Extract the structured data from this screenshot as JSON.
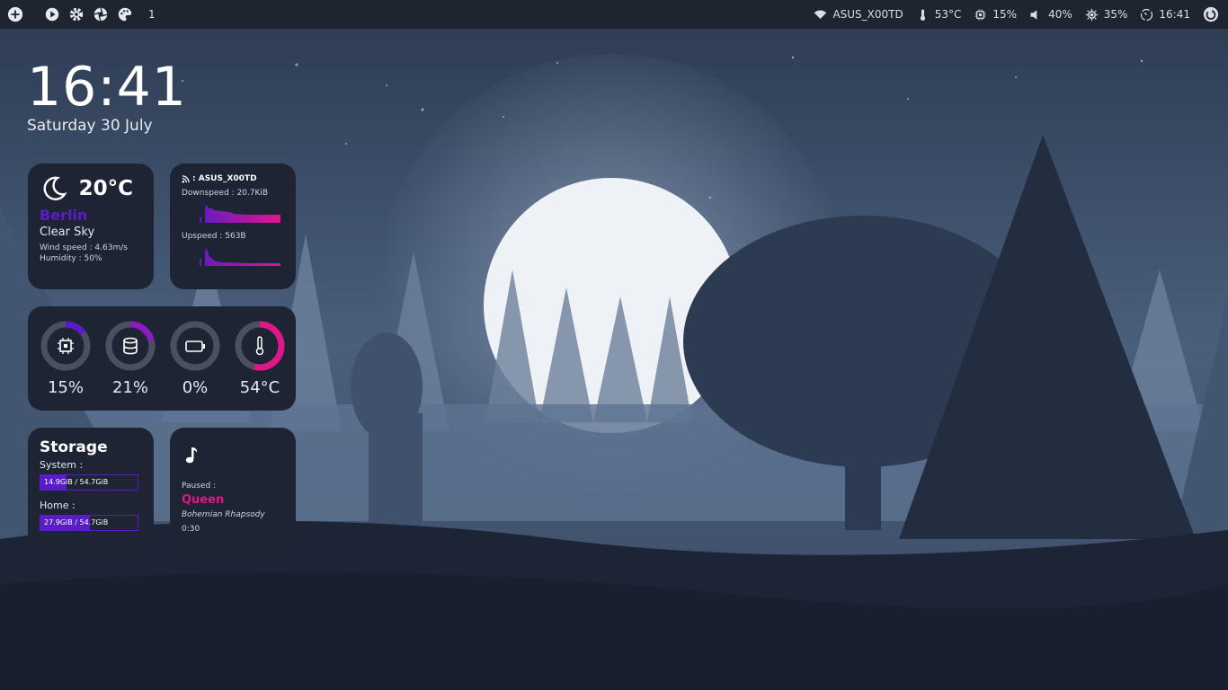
{
  "colors": {
    "bar_bg": "#1e2430",
    "card_bg": "#1e2433",
    "accent_purple": "#5a1cc8",
    "accent_pink": "#e0168a",
    "gauge_track": "#4a5060"
  },
  "topbar": {
    "left_icons": [
      "add-circle-icon",
      "play-icon",
      "settings-icon",
      "aperture-icon",
      "palette-icon"
    ],
    "workspace": "1",
    "wifi": {
      "icon": "wifi-icon",
      "label": "ASUS_X00TD"
    },
    "temp": {
      "icon": "thermometer-icon",
      "label": "53°C"
    },
    "cpu": {
      "icon": "cpu-icon",
      "label": "15%"
    },
    "volume": {
      "icon": "volume-icon",
      "label": "40%"
    },
    "brightness": {
      "icon": "brightness-icon",
      "label": "35%"
    },
    "clock": {
      "icon": "clock-icon",
      "label": "16:41"
    },
    "power": {
      "icon": "power-icon"
    }
  },
  "clock": {
    "time": "16:41",
    "date": "Saturday 30 July"
  },
  "weather": {
    "icon": "moon-icon",
    "temp": "20°C",
    "city": "Berlin",
    "condition": "Clear Sky",
    "wind": "Wind speed : 4.63m/s",
    "humidity": "Humidity : 50%"
  },
  "network": {
    "title": ": ASUS_X00TD",
    "down_label": "Downspeed : 20.7KiB",
    "up_label": "Upspeed : 563B"
  },
  "stats": [
    {
      "icon": "cpu-icon",
      "value": "15%",
      "fraction": 0.15
    },
    {
      "icon": "disk-icon",
      "value": "21%",
      "fraction": 0.21
    },
    {
      "icon": "battery-icon",
      "value": "0%",
      "fraction": 0.0
    },
    {
      "icon": "thermometer-icon",
      "value": "54°C",
      "fraction": 0.54
    }
  ],
  "storage": {
    "title": "Storage",
    "system_label": "System :",
    "system_text": "14.9GiB / 54.7GiB",
    "system_fraction": 0.27,
    "home_label": "Home :",
    "home_text": "27.9GiB / 54.7GiB",
    "home_fraction": 0.51
  },
  "music": {
    "icon": "music-note-icon",
    "status": "Paused :",
    "artist": "Queen",
    "song": "Bohemian Rhapsody",
    "time": "0:30"
  }
}
